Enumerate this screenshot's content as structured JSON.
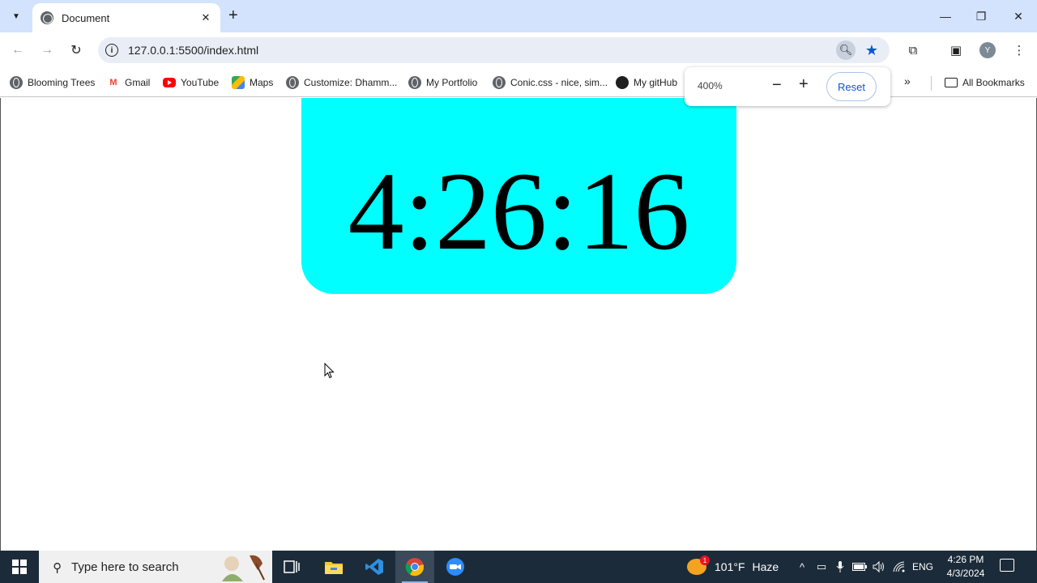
{
  "browser": {
    "tab": {
      "title": "Document"
    },
    "address": {
      "url": "127.0.0.1:5500/index.html"
    },
    "profile_initial": "Y",
    "zoom_popup": {
      "level": "400%",
      "minus": "−",
      "plus": "+",
      "reset_label": "Reset"
    }
  },
  "bookmarks": {
    "items": [
      {
        "label": "Blooming Trees",
        "icon": "globe-icon"
      },
      {
        "label": "Gmail",
        "icon": "gmail-icon"
      },
      {
        "label": "YouTube",
        "icon": "youtube-icon"
      },
      {
        "label": "Maps",
        "icon": "maps-icon"
      },
      {
        "label": "Customize: Dhamm...",
        "icon": "globe-icon"
      },
      {
        "label": "My Portfolio",
        "icon": "globe-icon"
      },
      {
        "label": "Conic.css - nice, sim...",
        "icon": "globe-icon"
      },
      {
        "label": "My gitHub",
        "icon": "github-icon"
      }
    ],
    "all_bookmarks": "All Bookmarks"
  },
  "page": {
    "clock_time": "4:26:16",
    "clock_bg": "#00ffff"
  },
  "taskbar": {
    "search_placeholder": "Type here to search",
    "weather": {
      "temp": "101°F",
      "condition": "Haze",
      "badge": "1"
    },
    "language": "ENG",
    "time": "4:26 PM",
    "date": "4/3/2024"
  }
}
